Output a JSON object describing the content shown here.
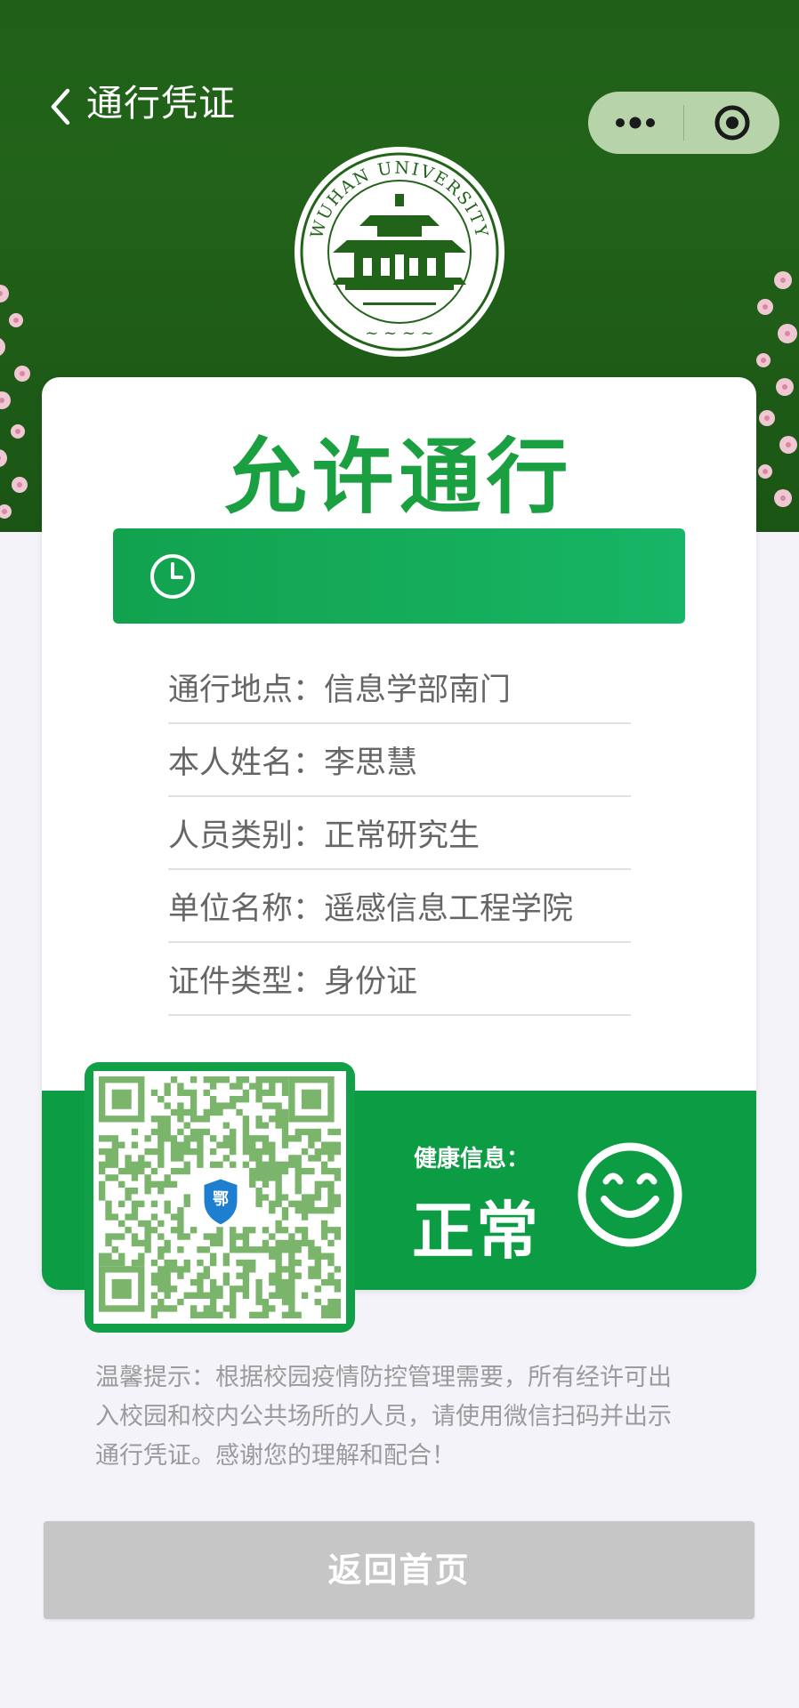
{
  "nav": {
    "title": "通行凭证",
    "back_icon": "chevron-left-icon",
    "more_icon": "more-dots-icon",
    "close_icon": "target-circle-icon"
  },
  "card": {
    "status_title": "允许通行",
    "time_icon": "clock-icon",
    "time_value": "",
    "info": [
      {
        "key": "通行地点：",
        "value": "信息学部南门"
      },
      {
        "key": "本人姓名：",
        "value": "李思慧"
      },
      {
        "key": "人员类别：",
        "value": "正常研究生"
      },
      {
        "key": "单位名称：",
        "value": "遥感信息工程学院"
      },
      {
        "key": "证件类型：",
        "value": "身份证"
      }
    ]
  },
  "qr": {
    "badge_text": "鄂",
    "badge_icon": "shield-icon"
  },
  "health": {
    "label": "健康信息：",
    "value": "正常",
    "icon": "smile-face-icon"
  },
  "tip": "温馨提示：根据校园疫情防控管理需要，所有经许可出入校园和校内公共场所的人员，请使用微信扫码并出示通行凭证。感谢您的理解和配合！",
  "back_button_label": "返回首页",
  "colors": {
    "header_green": "#22631a",
    "status_green": "#1aa040",
    "band_green": "#0c9c44",
    "button_gray": "#c6c6c6"
  }
}
